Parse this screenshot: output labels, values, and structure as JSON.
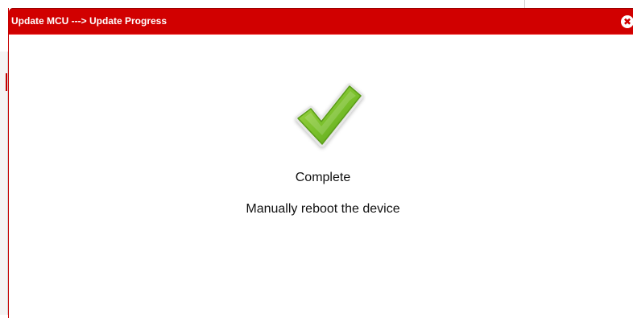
{
  "dialog": {
    "title": "Update MCU ---> Update Progress",
    "close_icon": "close-icon"
  },
  "status": {
    "icon": "checkmark-icon",
    "title": "Complete",
    "message": "Manually reboot the device"
  },
  "colors": {
    "titlebar": "#d10000",
    "check_green": "#7cc51f",
    "text": "#111111"
  }
}
